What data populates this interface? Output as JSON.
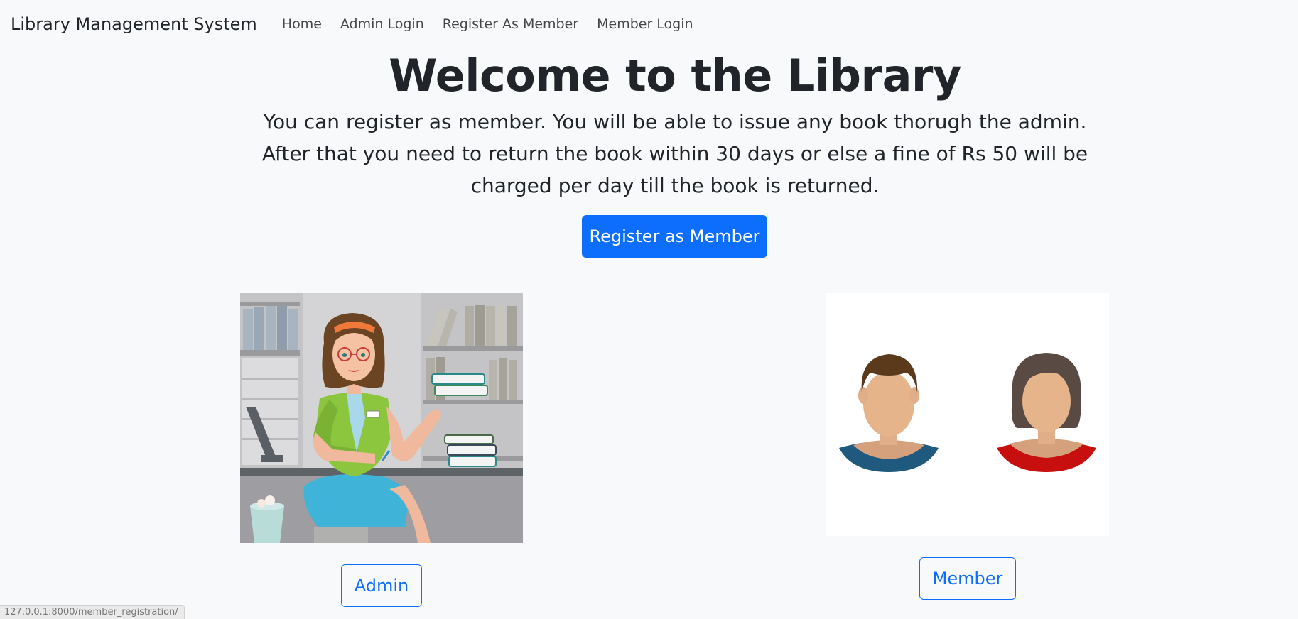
{
  "nav": {
    "brand": "Library Management System",
    "links": [
      "Home",
      "Admin Login",
      "Register As Member",
      "Member Login"
    ]
  },
  "hero": {
    "title": "Welcome to the Library",
    "text": "You can register as member. You will be able to issue any book thorugh the admin. After that you need to return the book within 30 days or else a fine of Rs 50 will be charged per day till the book is returned.",
    "button_label": "Register as Member"
  },
  "cards": {
    "admin_label": "Admin",
    "member_label": "Member"
  },
  "status_bar": {
    "url": "127.0.0.1:8000/member_registration/"
  },
  "colors": {
    "primary": "#0d6efd",
    "background": "#f8f9fa"
  }
}
